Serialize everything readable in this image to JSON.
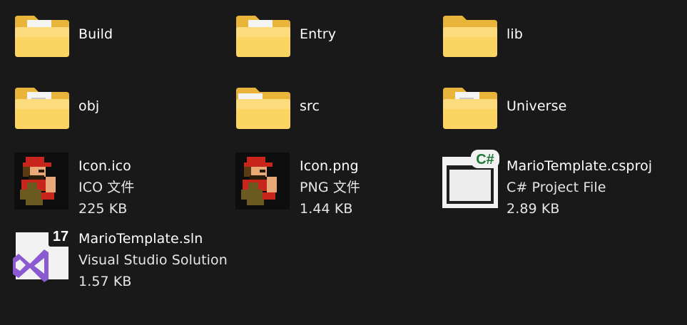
{
  "items": [
    {
      "name": "Build"
    },
    {
      "name": "Entry"
    },
    {
      "name": "lib"
    },
    {
      "name": "obj"
    },
    {
      "name": "src"
    },
    {
      "name": "Universe"
    },
    {
      "name": "Icon.ico",
      "type": "ICO 文件",
      "size": "225 KB"
    },
    {
      "name": "Icon.png",
      "type": "PNG 文件",
      "size": "1.44 KB"
    },
    {
      "name": "MarioTemplate.csproj",
      "type": "C# Project File",
      "size": "2.89 KB",
      "badge": "C#"
    },
    {
      "name": "MarioTemplate.sln",
      "type": "Visual Studio Solution",
      "size": "1.57 KB",
      "badge": "17"
    }
  ],
  "icons": {
    "folder_build": "folder-with-file-icon",
    "folder_entry": "folder-with-file-icon",
    "folder_lib": "folder-icon",
    "folder_obj": "folder-with-file-icon",
    "folder_src": "folder-icon",
    "folder_universe": "folder-with-file-icon",
    "icon_ico": "mario-image-icon",
    "icon_png": "mario-image-icon",
    "csproj": "csharp-project-icon",
    "sln": "visual-studio-solution-icon"
  },
  "colors": {
    "background": "#191919",
    "folder_front": "#fcd462",
    "folder_back": "#e8b43a",
    "text": "#ffffff",
    "vs_purple": "#8b5ad0"
  }
}
